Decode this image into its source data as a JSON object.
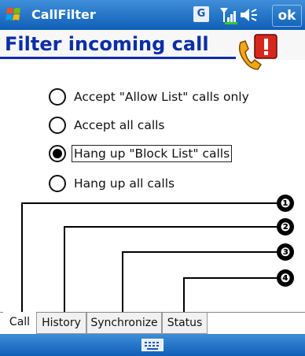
{
  "titlebar": {
    "app_name": "CallFilter",
    "network_badge": "G",
    "ok_label": "ok",
    "icons": [
      "windows-start-icon",
      "network-g-icon",
      "signal-strength-icon",
      "speaker-icon"
    ]
  },
  "header": {
    "title": "Filter incoming call",
    "icon": "phone-alert-icon"
  },
  "options": [
    {
      "label": "Accept \"Allow List\" calls only",
      "selected": false
    },
    {
      "label": "Accept all calls",
      "selected": false
    },
    {
      "label": "Hang up \"Block List\" calls",
      "selected": true
    },
    {
      "label": "Hang up all calls",
      "selected": false
    }
  ],
  "callouts": [
    "❶",
    "❷",
    "❸",
    "❹"
  ],
  "tabs": [
    {
      "label": "Call",
      "active": true
    },
    {
      "label": "History",
      "active": false
    },
    {
      "label": "Synchronize",
      "active": false
    },
    {
      "label": "Status",
      "active": false
    }
  ],
  "bottombar": {
    "icon": "keyboard-icon"
  },
  "colors": {
    "titlebar": "#1f6fc6",
    "header_text": "#0c2fa6"
  }
}
